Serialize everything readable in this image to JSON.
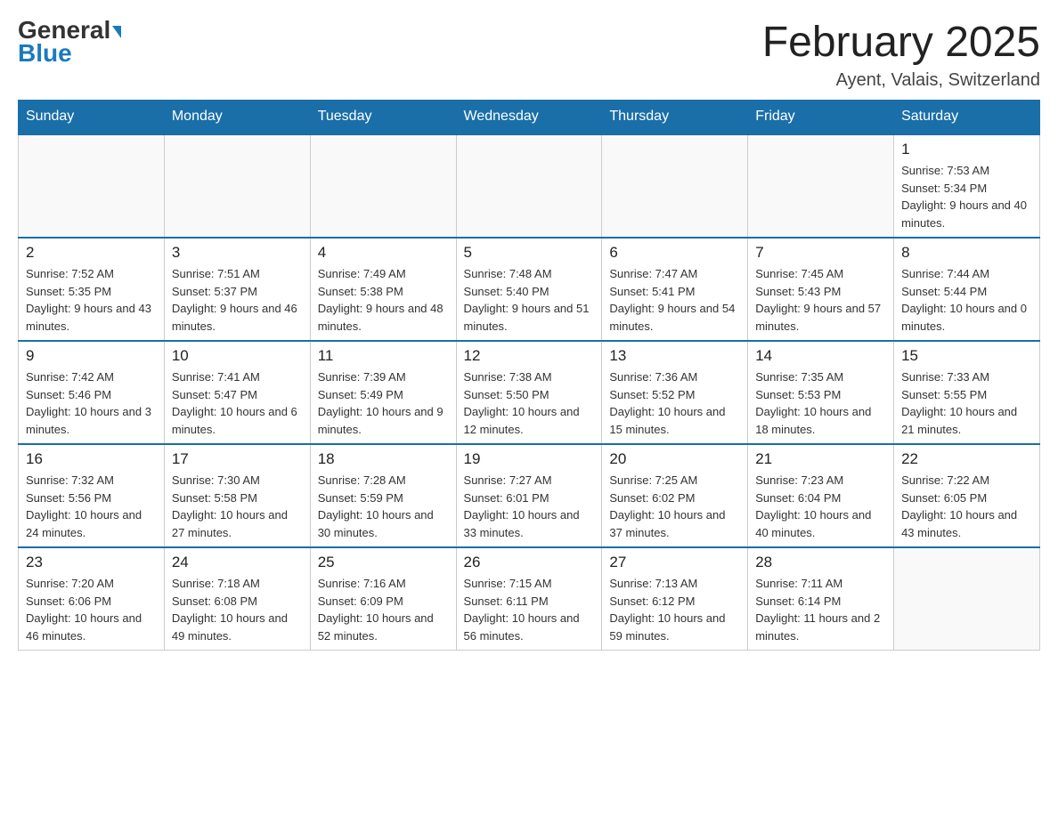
{
  "header": {
    "logo_general": "General",
    "logo_blue": "Blue",
    "month_title": "February 2025",
    "location": "Ayent, Valais, Switzerland"
  },
  "days_of_week": [
    "Sunday",
    "Monday",
    "Tuesday",
    "Wednesday",
    "Thursday",
    "Friday",
    "Saturday"
  ],
  "weeks": [
    [
      {
        "day": "",
        "info": ""
      },
      {
        "day": "",
        "info": ""
      },
      {
        "day": "",
        "info": ""
      },
      {
        "day": "",
        "info": ""
      },
      {
        "day": "",
        "info": ""
      },
      {
        "day": "",
        "info": ""
      },
      {
        "day": "1",
        "info": "Sunrise: 7:53 AM\nSunset: 5:34 PM\nDaylight: 9 hours and 40 minutes."
      }
    ],
    [
      {
        "day": "2",
        "info": "Sunrise: 7:52 AM\nSunset: 5:35 PM\nDaylight: 9 hours and 43 minutes."
      },
      {
        "day": "3",
        "info": "Sunrise: 7:51 AM\nSunset: 5:37 PM\nDaylight: 9 hours and 46 minutes."
      },
      {
        "day": "4",
        "info": "Sunrise: 7:49 AM\nSunset: 5:38 PM\nDaylight: 9 hours and 48 minutes."
      },
      {
        "day": "5",
        "info": "Sunrise: 7:48 AM\nSunset: 5:40 PM\nDaylight: 9 hours and 51 minutes."
      },
      {
        "day": "6",
        "info": "Sunrise: 7:47 AM\nSunset: 5:41 PM\nDaylight: 9 hours and 54 minutes."
      },
      {
        "day": "7",
        "info": "Sunrise: 7:45 AM\nSunset: 5:43 PM\nDaylight: 9 hours and 57 minutes."
      },
      {
        "day": "8",
        "info": "Sunrise: 7:44 AM\nSunset: 5:44 PM\nDaylight: 10 hours and 0 minutes."
      }
    ],
    [
      {
        "day": "9",
        "info": "Sunrise: 7:42 AM\nSunset: 5:46 PM\nDaylight: 10 hours and 3 minutes."
      },
      {
        "day": "10",
        "info": "Sunrise: 7:41 AM\nSunset: 5:47 PM\nDaylight: 10 hours and 6 minutes."
      },
      {
        "day": "11",
        "info": "Sunrise: 7:39 AM\nSunset: 5:49 PM\nDaylight: 10 hours and 9 minutes."
      },
      {
        "day": "12",
        "info": "Sunrise: 7:38 AM\nSunset: 5:50 PM\nDaylight: 10 hours and 12 minutes."
      },
      {
        "day": "13",
        "info": "Sunrise: 7:36 AM\nSunset: 5:52 PM\nDaylight: 10 hours and 15 minutes."
      },
      {
        "day": "14",
        "info": "Sunrise: 7:35 AM\nSunset: 5:53 PM\nDaylight: 10 hours and 18 minutes."
      },
      {
        "day": "15",
        "info": "Sunrise: 7:33 AM\nSunset: 5:55 PM\nDaylight: 10 hours and 21 minutes."
      }
    ],
    [
      {
        "day": "16",
        "info": "Sunrise: 7:32 AM\nSunset: 5:56 PM\nDaylight: 10 hours and 24 minutes."
      },
      {
        "day": "17",
        "info": "Sunrise: 7:30 AM\nSunset: 5:58 PM\nDaylight: 10 hours and 27 minutes."
      },
      {
        "day": "18",
        "info": "Sunrise: 7:28 AM\nSunset: 5:59 PM\nDaylight: 10 hours and 30 minutes."
      },
      {
        "day": "19",
        "info": "Sunrise: 7:27 AM\nSunset: 6:01 PM\nDaylight: 10 hours and 33 minutes."
      },
      {
        "day": "20",
        "info": "Sunrise: 7:25 AM\nSunset: 6:02 PM\nDaylight: 10 hours and 37 minutes."
      },
      {
        "day": "21",
        "info": "Sunrise: 7:23 AM\nSunset: 6:04 PM\nDaylight: 10 hours and 40 minutes."
      },
      {
        "day": "22",
        "info": "Sunrise: 7:22 AM\nSunset: 6:05 PM\nDaylight: 10 hours and 43 minutes."
      }
    ],
    [
      {
        "day": "23",
        "info": "Sunrise: 7:20 AM\nSunset: 6:06 PM\nDaylight: 10 hours and 46 minutes."
      },
      {
        "day": "24",
        "info": "Sunrise: 7:18 AM\nSunset: 6:08 PM\nDaylight: 10 hours and 49 minutes."
      },
      {
        "day": "25",
        "info": "Sunrise: 7:16 AM\nSunset: 6:09 PM\nDaylight: 10 hours and 52 minutes."
      },
      {
        "day": "26",
        "info": "Sunrise: 7:15 AM\nSunset: 6:11 PM\nDaylight: 10 hours and 56 minutes."
      },
      {
        "day": "27",
        "info": "Sunrise: 7:13 AM\nSunset: 6:12 PM\nDaylight: 10 hours and 59 minutes."
      },
      {
        "day": "28",
        "info": "Sunrise: 7:11 AM\nSunset: 6:14 PM\nDaylight: 11 hours and 2 minutes."
      },
      {
        "day": "",
        "info": ""
      }
    ]
  ]
}
